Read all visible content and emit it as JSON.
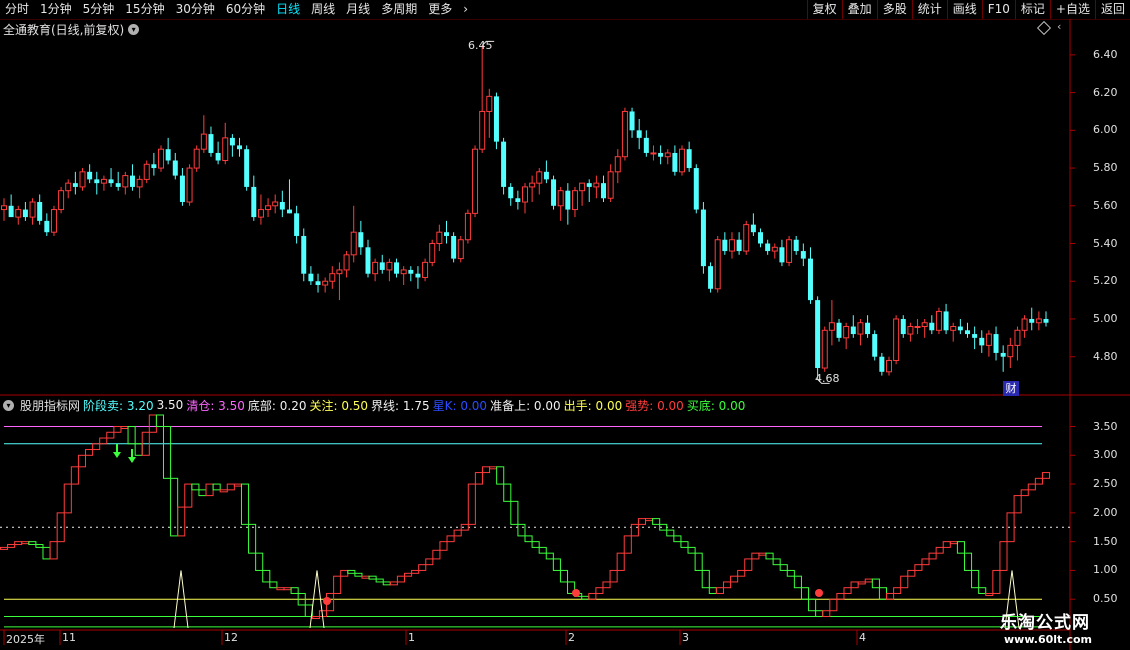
{
  "toolbar": {
    "tabs": [
      {
        "label": "分时"
      },
      {
        "label": "1分钟"
      },
      {
        "label": "5分钟"
      },
      {
        "label": "15分钟"
      },
      {
        "label": "30分钟"
      },
      {
        "label": "60分钟"
      },
      {
        "label": "日线",
        "active": true
      },
      {
        "label": "周线"
      },
      {
        "label": "月线"
      },
      {
        "label": "多周期"
      },
      {
        "label": "更多"
      }
    ],
    "more_icon": "chevron-right-icon",
    "buttons": [
      {
        "label": "复权"
      },
      {
        "label": "叠加"
      },
      {
        "label": "多股"
      },
      {
        "label": "统计"
      },
      {
        "label": "画线"
      },
      {
        "label": "F10"
      },
      {
        "label": "标记"
      },
      {
        "label": "+自选"
      },
      {
        "label": "返回"
      }
    ]
  },
  "main_chart": {
    "title": "全通教育(日线,前复权)",
    "price_ticks": [
      "6.40",
      "6.20",
      "6.00",
      "5.80",
      "5.60",
      "5.40",
      "5.20",
      "5.00",
      "4.80"
    ],
    "high_label": "6.45",
    "low_label": "4.68",
    "badge": "财",
    "colors": {
      "up": "#ff3c3c",
      "down": "#54ffff",
      "axis": "#aa0000"
    }
  },
  "indicator": {
    "name": "股朋指标网",
    "params": [
      {
        "label": "阶段卖:",
        "value": "3.20",
        "color": "#54ffff"
      },
      {
        "label": "",
        "value": "3.50",
        "color": "#f0f0f0"
      },
      {
        "label": "清仓:",
        "value": "3.50",
        "color": "#ff66ff"
      },
      {
        "label": "底部:",
        "value": "0.20",
        "color": "#f0f0f0"
      },
      {
        "label": "关注:",
        "value": "0.50",
        "color": "#ffff55"
      },
      {
        "label": "界线:",
        "value": "1.75",
        "color": "#f0f0f0"
      },
      {
        "label": "星K:",
        "value": "0.00",
        "color": "#2a4cff"
      },
      {
        "label": "准备上:",
        "value": "0.00",
        "color": "#f0f0f0"
      },
      {
        "label": "出手:",
        "value": "0.00",
        "color": "#ffff55"
      },
      {
        "label": "强势:",
        "value": "0.00",
        "color": "#ff3c3c"
      },
      {
        "label": "买底:",
        "value": "0.00",
        "color": "#3cff3c"
      }
    ],
    "ticks": [
      "3.50",
      "3.00",
      "2.50",
      "2.00",
      "1.50",
      "1.00",
      "0.50"
    ]
  },
  "x_axis": {
    "labels": [
      {
        "text": "2025年"
      },
      {
        "text": "11"
      },
      {
        "text": "12"
      },
      {
        "text": "1"
      },
      {
        "text": "2"
      },
      {
        "text": "3"
      },
      {
        "text": "4"
      }
    ]
  },
  "watermark": {
    "title": "乐淘公式网",
    "url": "www.60lt.com"
  },
  "chart_data": [
    {
      "type": "candlestick",
      "title": "全通教育(日线,前复权)",
      "ylim": [
        4.65,
        6.5
      ],
      "ohlc": [
        [
          5.58,
          5.64,
          5.52,
          5.6
        ],
        [
          5.6,
          5.66,
          5.56,
          5.54
        ],
        [
          5.54,
          5.6,
          5.5,
          5.58
        ],
        [
          5.58,
          5.62,
          5.52,
          5.54
        ],
        [
          5.54,
          5.64,
          5.5,
          5.62
        ],
        [
          5.62,
          5.66,
          5.5,
          5.52
        ],
        [
          5.52,
          5.56,
          5.44,
          5.46
        ],
        [
          5.46,
          5.6,
          5.44,
          5.58
        ],
        [
          5.58,
          5.7,
          5.56,
          5.68
        ],
        [
          5.68,
          5.74,
          5.64,
          5.72
        ],
        [
          5.72,
          5.78,
          5.66,
          5.7
        ],
        [
          5.7,
          5.8,
          5.68,
          5.78
        ],
        [
          5.78,
          5.82,
          5.72,
          5.74
        ],
        [
          5.74,
          5.78,
          5.66,
          5.72
        ],
        [
          5.72,
          5.76,
          5.68,
          5.74
        ],
        [
          5.74,
          5.8,
          5.7,
          5.72
        ],
        [
          5.72,
          5.78,
          5.68,
          5.7
        ],
        [
          5.7,
          5.78,
          5.66,
          5.76
        ],
        [
          5.76,
          5.82,
          5.68,
          5.7
        ],
        [
          5.7,
          5.76,
          5.64,
          5.74
        ],
        [
          5.74,
          5.84,
          5.72,
          5.82
        ],
        [
          5.82,
          5.88,
          5.76,
          5.8
        ],
        [
          5.8,
          5.92,
          5.78,
          5.9
        ],
        [
          5.9,
          5.96,
          5.82,
          5.84
        ],
        [
          5.84,
          5.88,
          5.74,
          5.76
        ],
        [
          5.76,
          5.8,
          5.6,
          5.62
        ],
        [
          5.62,
          5.82,
          5.6,
          5.8
        ],
        [
          5.8,
          5.92,
          5.78,
          5.9
        ],
        [
          5.9,
          6.08,
          5.88,
          5.98
        ],
        [
          5.98,
          6.02,
          5.86,
          5.88
        ],
        [
          5.88,
          5.94,
          5.82,
          5.84
        ],
        [
          5.84,
          6.04,
          5.82,
          5.96
        ],
        [
          5.96,
          5.98,
          5.86,
          5.92
        ],
        [
          5.92,
          5.96,
          5.86,
          5.9
        ],
        [
          5.9,
          5.92,
          5.68,
          5.7
        ],
        [
          5.7,
          5.76,
          5.52,
          5.54
        ],
        [
          5.54,
          5.66,
          5.5,
          5.58
        ],
        [
          5.58,
          5.64,
          5.54,
          5.6
        ],
        [
          5.6,
          5.66,
          5.56,
          5.62
        ],
        [
          5.62,
          5.68,
          5.54,
          5.58
        ],
        [
          5.58,
          5.74,
          5.56,
          5.56
        ],
        [
          5.56,
          5.6,
          5.4,
          5.44
        ],
        [
          5.44,
          5.48,
          5.2,
          5.24
        ],
        [
          5.24,
          5.28,
          5.18,
          5.2
        ],
        [
          5.2,
          5.24,
          5.14,
          5.18
        ],
        [
          5.18,
          5.22,
          5.14,
          5.2
        ],
        [
          5.2,
          5.28,
          5.16,
          5.24
        ],
        [
          5.24,
          5.3,
          5.1,
          5.26
        ],
        [
          5.26,
          5.36,
          5.22,
          5.34
        ],
        [
          5.34,
          5.6,
          5.3,
          5.46
        ],
        [
          5.46,
          5.52,
          5.34,
          5.38
        ],
        [
          5.38,
          5.42,
          5.22,
          5.24
        ],
        [
          5.24,
          5.32,
          5.2,
          5.3
        ],
        [
          5.3,
          5.34,
          5.24,
          5.26
        ],
        [
          5.26,
          5.32,
          5.2,
          5.3
        ],
        [
          5.3,
          5.32,
          5.22,
          5.24
        ],
        [
          5.24,
          5.28,
          5.18,
          5.26
        ],
        [
          5.26,
          5.28,
          5.2,
          5.24
        ],
        [
          5.24,
          5.28,
          5.16,
          5.22
        ],
        [
          5.22,
          5.32,
          5.2,
          5.3
        ],
        [
          5.3,
          5.42,
          5.28,
          5.4
        ],
        [
          5.4,
          5.5,
          5.36,
          5.46
        ],
        [
          5.46,
          5.52,
          5.4,
          5.44
        ],
        [
          5.44,
          5.46,
          5.3,
          5.32
        ],
        [
          5.32,
          5.44,
          5.3,
          5.42
        ],
        [
          5.42,
          5.58,
          5.4,
          5.56
        ],
        [
          5.56,
          5.92,
          5.54,
          5.9
        ],
        [
          5.9,
          6.45,
          5.88,
          6.1
        ],
        [
          6.1,
          6.22,
          5.96,
          6.18
        ],
        [
          6.18,
          6.2,
          5.9,
          5.94
        ],
        [
          5.94,
          5.96,
          5.66,
          5.7
        ],
        [
          5.7,
          5.72,
          5.6,
          5.64
        ],
        [
          5.64,
          5.68,
          5.58,
          5.62
        ],
        [
          5.62,
          5.72,
          5.56,
          5.7
        ],
        [
          5.7,
          5.76,
          5.62,
          5.72
        ],
        [
          5.72,
          5.8,
          5.66,
          5.78
        ],
        [
          5.78,
          5.84,
          5.72,
          5.74
        ],
        [
          5.74,
          5.76,
          5.58,
          5.6
        ],
        [
          5.6,
          5.7,
          5.52,
          5.68
        ],
        [
          5.68,
          5.72,
          5.5,
          5.58
        ],
        [
          5.58,
          5.7,
          5.54,
          5.68
        ],
        [
          5.68,
          5.7,
          5.6,
          5.72
        ],
        [
          5.72,
          5.74,
          5.62,
          5.7
        ],
        [
          5.7,
          5.76,
          5.64,
          5.72
        ],
        [
          5.72,
          5.76,
          5.62,
          5.64
        ],
        [
          5.64,
          5.82,
          5.62,
          5.78
        ],
        [
          5.78,
          5.9,
          5.72,
          5.86
        ],
        [
          5.86,
          6.12,
          5.84,
          6.1
        ],
        [
          6.1,
          6.12,
          5.96,
          6.0
        ],
        [
          6.0,
          6.06,
          5.9,
          5.96
        ],
        [
          5.96,
          6.0,
          5.86,
          5.88
        ],
        [
          5.88,
          5.92,
          5.84,
          5.88
        ],
        [
          5.88,
          5.92,
          5.82,
          5.86
        ],
        [
          5.86,
          5.9,
          5.82,
          5.88
        ],
        [
          5.88,
          5.92,
          5.76,
          5.78
        ],
        [
          5.78,
          5.92,
          5.76,
          5.9
        ],
        [
          5.9,
          5.94,
          5.78,
          5.8
        ],
        [
          5.8,
          5.82,
          5.56,
          5.58
        ],
        [
          5.58,
          5.62,
          5.24,
          5.28
        ],
        [
          5.28,
          5.3,
          5.14,
          5.16
        ],
        [
          5.16,
          5.44,
          5.14,
          5.42
        ],
        [
          5.42,
          5.46,
          5.34,
          5.36
        ],
        [
          5.36,
          5.46,
          5.32,
          5.42
        ],
        [
          5.42,
          5.46,
          5.34,
          5.36
        ],
        [
          5.36,
          5.52,
          5.34,
          5.5
        ],
        [
          5.5,
          5.56,
          5.44,
          5.46
        ],
        [
          5.46,
          5.48,
          5.38,
          5.4
        ],
        [
          5.4,
          5.42,
          5.34,
          5.36
        ],
        [
          5.36,
          5.4,
          5.32,
          5.38
        ],
        [
          5.38,
          5.42,
          5.28,
          5.3
        ],
        [
          5.3,
          5.44,
          5.28,
          5.42
        ],
        [
          5.42,
          5.44,
          5.34,
          5.36
        ],
        [
          5.36,
          5.4,
          5.28,
          5.32
        ],
        [
          5.32,
          5.38,
          5.08,
          5.1
        ],
        [
          5.1,
          5.12,
          4.68,
          4.74
        ],
        [
          4.74,
          4.96,
          4.72,
          4.94
        ],
        [
          4.94,
          5.1,
          4.86,
          4.98
        ],
        [
          4.98,
          5.0,
          4.88,
          4.9
        ],
        [
          4.9,
          4.98,
          4.84,
          4.96
        ],
        [
          4.96,
          5.02,
          4.9,
          4.92
        ],
        [
          4.92,
          5.0,
          4.86,
          4.98
        ],
        [
          4.98,
          5.02,
          4.9,
          4.92
        ],
        [
          4.92,
          4.94,
          4.78,
          4.8
        ],
        [
          4.8,
          4.82,
          4.7,
          4.72
        ],
        [
          4.72,
          4.8,
          4.7,
          4.78
        ],
        [
          4.78,
          5.02,
          4.76,
          5.0
        ],
        [
          5.0,
          5.02,
          4.9,
          4.92
        ],
        [
          4.92,
          4.98,
          4.88,
          4.96
        ],
        [
          4.96,
          5.0,
          4.92,
          4.96
        ],
        [
          4.96,
          5.0,
          4.9,
          4.98
        ],
        [
          4.98,
          5.02,
          4.92,
          4.94
        ],
        [
          4.94,
          5.06,
          4.92,
          5.04
        ],
        [
          5.04,
          5.08,
          4.92,
          4.94
        ],
        [
          4.94,
          4.98,
          4.88,
          4.96
        ],
        [
          4.96,
          5.0,
          4.92,
          4.94
        ],
        [
          4.94,
          4.98,
          4.9,
          4.92
        ],
        [
          4.92,
          4.96,
          4.84,
          4.9
        ],
        [
          4.9,
          4.94,
          4.82,
          4.86
        ],
        [
          4.86,
          4.94,
          4.8,
          4.92
        ],
        [
          4.92,
          4.96,
          4.78,
          4.82
        ],
        [
          4.82,
          4.86,
          4.72,
          4.8
        ],
        [
          4.8,
          4.9,
          4.74,
          4.86
        ],
        [
          4.86,
          4.96,
          4.78,
          4.94
        ],
        [
          4.94,
          5.02,
          4.9,
          5.0
        ],
        [
          5.0,
          5.06,
          4.94,
          4.98
        ],
        [
          4.98,
          5.04,
          4.94,
          5.0
        ],
        [
          5.0,
          5.04,
          4.96,
          4.98
        ]
      ]
    },
    {
      "type": "step-line",
      "name": "股朋指标网",
      "ylim": [
        0.0,
        3.7
      ],
      "reference_lines": [
        3.5,
        3.2,
        1.75,
        0.5
      ],
      "values": [
        1.4,
        1.45,
        1.5,
        1.5,
        1.45,
        1.4,
        1.2,
        1.5,
        2.0,
        2.5,
        2.8,
        3.0,
        3.1,
        3.2,
        3.3,
        3.4,
        3.5,
        3.5,
        3.2,
        3.0,
        3.4,
        3.7,
        3.5,
        2.6,
        1.6,
        2.1,
        2.5,
        2.4,
        2.3,
        2.5,
        2.4,
        2.4,
        2.5,
        2.5,
        1.8,
        1.3,
        1.0,
        0.8,
        0.7,
        0.7,
        0.7,
        0.6,
        0.4,
        0.2,
        0.2,
        0.3,
        0.6,
        0.9,
        1.0,
        0.95,
        0.9,
        0.9,
        0.85,
        0.8,
        0.75,
        0.8,
        0.9,
        0.95,
        1.0,
        1.1,
        1.2,
        1.35,
        1.5,
        1.6,
        1.7,
        1.8,
        2.5,
        2.7,
        2.8,
        2.8,
        2.5,
        2.2,
        1.8,
        1.6,
        1.5,
        1.4,
        1.3,
        1.2,
        1.0,
        0.8,
        0.6,
        0.55,
        0.5,
        0.6,
        0.7,
        0.8,
        1.0,
        1.3,
        1.6,
        1.8,
        1.9,
        1.9,
        1.8,
        1.7,
        1.6,
        1.5,
        1.4,
        1.3,
        1.0,
        0.7,
        0.6,
        0.7,
        0.8,
        0.9,
        1.0,
        1.2,
        1.3,
        1.3,
        1.2,
        1.1,
        1.0,
        0.9,
        0.7,
        0.5,
        0.3,
        0.2,
        0.3,
        0.5,
        0.6,
        0.7,
        0.8,
        0.8,
        0.85,
        0.7,
        0.5,
        0.6,
        0.7,
        0.9,
        1.0,
        1.1,
        1.2,
        1.3,
        1.4,
        1.5,
        1.5,
        1.3,
        1.0,
        0.7,
        0.6,
        0.6,
        1.0,
        1.5,
        2.0,
        2.3,
        2.4,
        2.5,
        2.6,
        2.7
      ]
    }
  ]
}
